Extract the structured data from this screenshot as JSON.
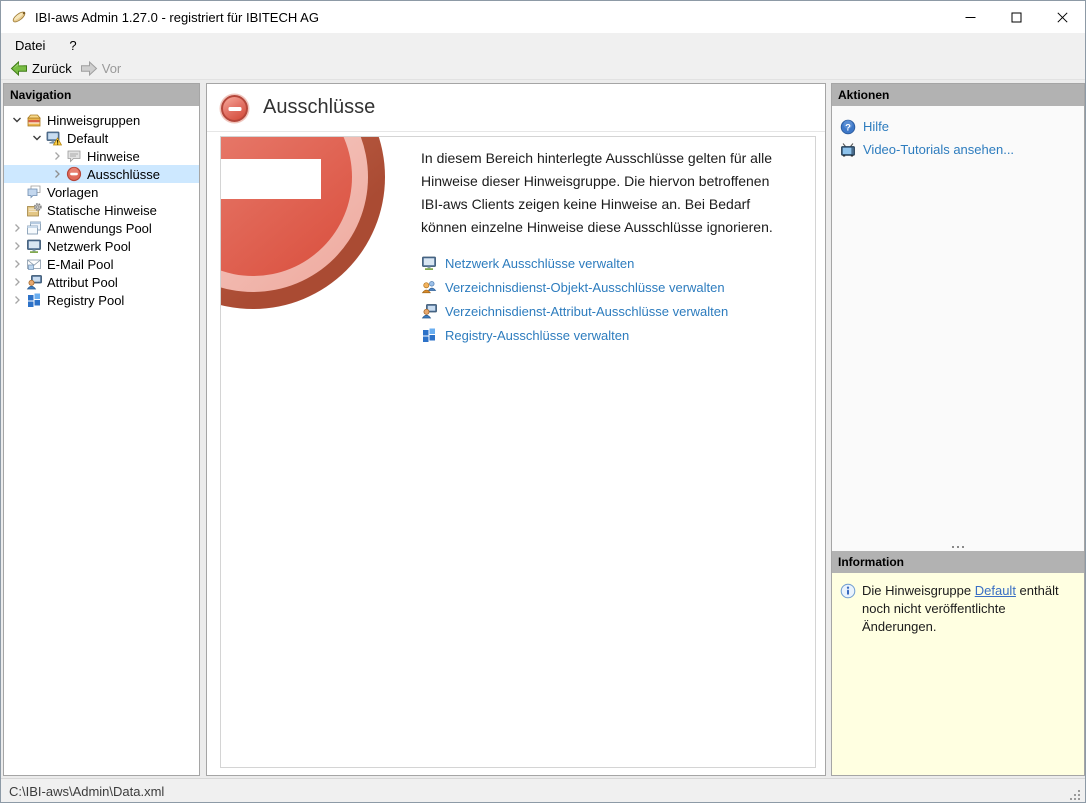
{
  "window": {
    "title": "IBI-aws Admin 1.27.0 - registriert für IBITECH AG",
    "app_icon": "stylus-icon",
    "controls": [
      "minimize",
      "maximize",
      "close"
    ]
  },
  "menu": {
    "items": [
      {
        "label": "Datei"
      },
      {
        "label": "?"
      }
    ]
  },
  "toolbar": {
    "back_label": "Zurück",
    "forward_label": "Vor"
  },
  "navigation": {
    "header": "Navigation",
    "items": [
      {
        "label": "Hinweisgruppen",
        "icon": "package-icon",
        "level": 0,
        "chevron": "down",
        "selected": false
      },
      {
        "label": "Default",
        "icon": "monitor-warning-icon",
        "level": 1,
        "chevron": "down",
        "selected": false
      },
      {
        "label": "Hinweise",
        "icon": "speech-bubble-icon",
        "level": 2,
        "chevron": "right",
        "selected": false
      },
      {
        "label": "Ausschlüsse",
        "icon": "prohibition-icon",
        "level": 2,
        "chevron": "right",
        "selected": true
      },
      {
        "label": "Vorlagen",
        "icon": "templates-icon",
        "level": 0,
        "chevron": "none",
        "selected": false
      },
      {
        "label": "Statische Hinweise",
        "icon": "static-note-icon",
        "level": 0,
        "chevron": "none",
        "selected": false
      },
      {
        "label": "Anwendungs Pool",
        "icon": "applications-icon",
        "level": 0,
        "chevron": "right",
        "selected": false
      },
      {
        "label": "Netzwerk Pool",
        "icon": "network-monitor-icon",
        "level": 0,
        "chevron": "right",
        "selected": false
      },
      {
        "label": "E-Mail Pool",
        "icon": "email-icon",
        "level": 0,
        "chevron": "right",
        "selected": false
      },
      {
        "label": "Attribut Pool",
        "icon": "person-monitor-icon",
        "level": 0,
        "chevron": "right",
        "selected": false
      },
      {
        "label": "Registry Pool",
        "icon": "registry-grid-icon",
        "level": 0,
        "chevron": "right",
        "selected": false
      }
    ]
  },
  "main": {
    "title": "Ausschlüsse",
    "description": "In diesem Bereich hinterlegte Ausschlüsse gelten für alle Hinweise dieser Hinweisgruppe. Die hiervon betroffenen IBI-aws Clients zeigen keine Hinweise an. Bei Bedarf können einzelne Hinweise diese Ausschlüsse ignorieren.",
    "links": [
      {
        "label": "Netzwerk Ausschlüsse verwalten",
        "icon": "network-monitor-icon"
      },
      {
        "label": "Verzeichnisdienst-Objekt-Ausschlüsse verwalten",
        "icon": "directory-users-icon"
      },
      {
        "label": "Verzeichnisdienst-Attribut-Ausschlüsse verwalten",
        "icon": "person-monitor-icon"
      },
      {
        "label": "Registry-Ausschlüsse verwalten",
        "icon": "registry-grid-icon"
      }
    ]
  },
  "actions": {
    "header": "Aktionen",
    "links": [
      {
        "label": "Hilfe",
        "icon": "help-icon"
      },
      {
        "label": "Video-Tutorials ansehen...",
        "icon": "tv-icon"
      }
    ]
  },
  "information": {
    "header": "Information",
    "icon": "info-icon",
    "text_before": "Die Hinweisgruppe ",
    "link_label": "Default",
    "text_after": " enthält noch nicht veröffentlichte Änderungen."
  },
  "statusbar": {
    "path": "C:\\IBI-aws\\Admin\\Data.xml"
  },
  "colors": {
    "link_blue": "#2d7cbe",
    "selection_blue": "#cde8ff",
    "panel_header_gray": "#b2b2b2",
    "info_yellow": "#ffffe1",
    "prohibition_red": "#dc5746",
    "back_arrow_green": "#6fb33c"
  }
}
